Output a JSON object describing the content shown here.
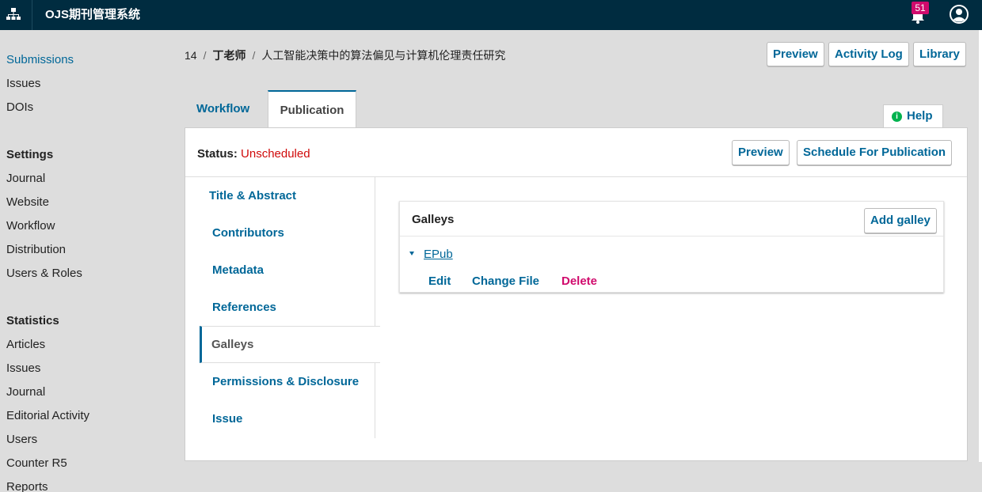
{
  "topbar": {
    "brand": "OJS期刊管理系统",
    "notification_count": "51",
    "icons": [
      "sitemap-icon",
      "bell-icon",
      "user-icon"
    ]
  },
  "sidebar": {
    "items_top": [
      {
        "label": "Submissions",
        "active": true
      },
      {
        "label": "Issues"
      },
      {
        "label": "DOIs"
      }
    ],
    "settings": {
      "heading": "Settings",
      "items": [
        "Journal",
        "Website",
        "Workflow",
        "Distribution",
        "Users & Roles"
      ]
    },
    "statistics": {
      "heading": "Statistics",
      "items": [
        "Articles",
        "Issues",
        "Journal",
        "Editorial Activity",
        "Users",
        "Counter R5",
        "Reports"
      ]
    }
  },
  "breadcrumb": {
    "id": "14",
    "author": "丁老师",
    "title": "人工智能决策中的算法偏见与计算机伦理责任研究"
  },
  "header_buttons": {
    "preview": "Preview",
    "activity_log": "Activity Log",
    "library": "Library"
  },
  "tabs": {
    "workflow": "Workflow",
    "publication": "Publication"
  },
  "help": "Help",
  "status": {
    "label": "Status:",
    "value": "Unscheduled"
  },
  "panel_buttons": {
    "preview": "Preview",
    "schedule": "Schedule For Publication"
  },
  "subnav": {
    "items": [
      "Title & Abstract",
      "Contributors",
      "Metadata",
      "References",
      "Galleys",
      "Permissions & Disclosure",
      "Issue"
    ],
    "selected": "Galleys"
  },
  "galleys": {
    "title": "Galleys",
    "add_label": "Add galley",
    "rows": [
      {
        "name": "EPub",
        "actions": {
          "edit": "Edit",
          "change": "Change File",
          "delete": "Delete"
        }
      }
    ]
  },
  "colors": {
    "topbar": "#002c40",
    "link": "#006798",
    "danger": "#d00a6c",
    "status": "#d00a0a",
    "help_info": "#00b24e"
  }
}
